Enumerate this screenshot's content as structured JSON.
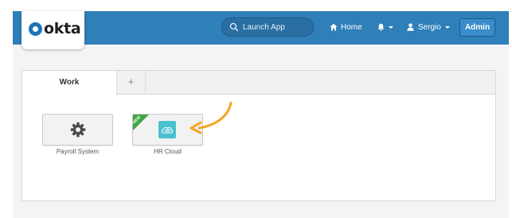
{
  "header": {
    "logo_text": "okta",
    "search": {
      "placeholder": "Launch App",
      "icon": "search-icon"
    },
    "home_label": "Home",
    "notifications_icon": "bell-icon",
    "user_name": "Sergio",
    "admin_label": "Admin"
  },
  "tabs": [
    {
      "label": "Work",
      "selected": true
    },
    {
      "label": "+",
      "selected": false
    }
  ],
  "apps": [
    {
      "label": "Payroll System",
      "icon": "gear-icon"
    },
    {
      "label": "HR Cloud",
      "icon": "hr-cloud-logo",
      "badge": "NEW",
      "badge_color": "#3ea744"
    }
  ],
  "colors": {
    "header_bg": "#2f7fb8",
    "hr_logo": "#4bc1cf",
    "arrow": "#f5a623"
  }
}
